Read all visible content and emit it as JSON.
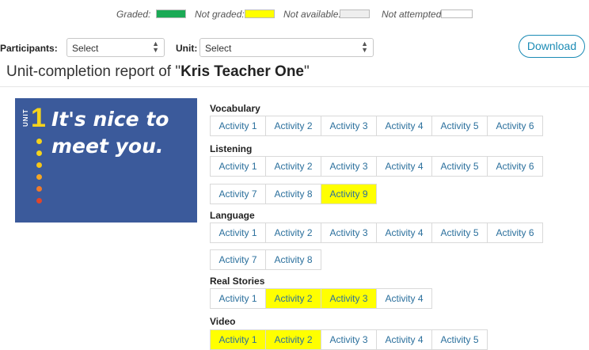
{
  "legend": {
    "graded": "Graded:",
    "not_graded": "Not graded:",
    "not_available": "Not available:",
    "not_attempted": "Not attempted:",
    "colors": {
      "graded": "#1aaa55",
      "not_graded": "#ffff00",
      "not_available": "#eeeeee",
      "not_attempted": "#ffffff"
    }
  },
  "filters": {
    "participants_label": "Participants:",
    "participants_value": "Select",
    "unit_label": "Unit:",
    "unit_value": "Select",
    "download_label": "Download"
  },
  "report": {
    "title_prefix": "Unit-completion report of \"",
    "name": "Kris Teacher One",
    "title_suffix": "\""
  },
  "unit_image": {
    "tag": "UNIT",
    "number": "1",
    "headline_1": "It's nice to",
    "headline_2": "meet you."
  },
  "sections": [
    {
      "title": "Vocabulary",
      "rows": [
        [
          {
            "label": "Activity 1",
            "status": "none"
          },
          {
            "label": "Activity 2",
            "status": "none"
          },
          {
            "label": "Activity 3",
            "status": "none"
          },
          {
            "label": "Activity 4",
            "status": "none"
          },
          {
            "label": "Activity 5",
            "status": "none"
          },
          {
            "label": "Activity 6",
            "status": "none"
          }
        ]
      ]
    },
    {
      "title": "Listening",
      "rows": [
        [
          {
            "label": "Activity 1",
            "status": "none"
          },
          {
            "label": "Activity 2",
            "status": "none"
          },
          {
            "label": "Activity 3",
            "status": "none"
          },
          {
            "label": "Activity 4",
            "status": "none"
          },
          {
            "label": "Activity 5",
            "status": "none"
          },
          {
            "label": "Activity 6",
            "status": "none"
          }
        ],
        [
          {
            "label": "Activity 7",
            "status": "none"
          },
          {
            "label": "Activity 8",
            "status": "none"
          },
          {
            "label": "Activity 9",
            "status": "not_graded"
          }
        ]
      ]
    },
    {
      "title": "Language",
      "rows": [
        [
          {
            "label": "Activity 1",
            "status": "none"
          },
          {
            "label": "Activity 2",
            "status": "none"
          },
          {
            "label": "Activity 3",
            "status": "none"
          },
          {
            "label": "Activity 4",
            "status": "none"
          },
          {
            "label": "Activity 5",
            "status": "none"
          },
          {
            "label": "Activity 6",
            "status": "none"
          }
        ],
        [
          {
            "label": "Activity 7",
            "status": "none"
          },
          {
            "label": "Activity 8",
            "status": "none"
          }
        ]
      ]
    },
    {
      "title": "Real Stories",
      "rows": [
        [
          {
            "label": "Activity 1",
            "status": "none"
          },
          {
            "label": "Activity 2",
            "status": "not_graded"
          },
          {
            "label": "Activity 3",
            "status": "not_graded"
          },
          {
            "label": "Activity 4",
            "status": "none"
          }
        ]
      ]
    },
    {
      "title": "Video",
      "rows": [
        [
          {
            "label": "Activity 1",
            "status": "not_graded"
          },
          {
            "label": "Activity 2",
            "status": "not_graded"
          },
          {
            "label": "Activity 3",
            "status": "none"
          },
          {
            "label": "Activity 4",
            "status": "none"
          },
          {
            "label": "Activity 5",
            "status": "none"
          }
        ]
      ]
    }
  ]
}
